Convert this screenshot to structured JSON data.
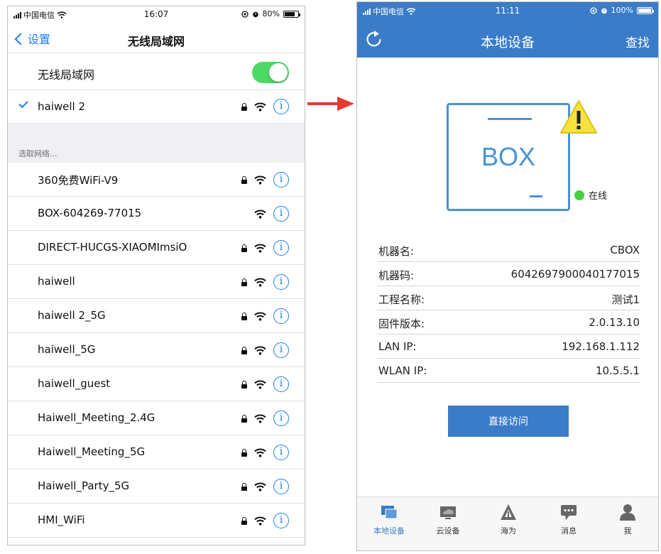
{
  "left_phone": {
    "status": {
      "carrier": "中国电信",
      "time": "16:07",
      "battery": "80%",
      "battery_level": 0.8
    },
    "nav": {
      "back_label": "设置",
      "title": "无线局域网"
    },
    "wlan": {
      "label": "无线局域网",
      "enabled": true
    },
    "connected": {
      "name": "haiwell 2",
      "locked": true
    },
    "section_header": "选取网络...",
    "networks": [
      {
        "name": "360免费WiFi-V9",
        "locked": true
      },
      {
        "name": "BOX-604269-77015",
        "locked": false
      },
      {
        "name": "DIRECT-HUCGS-XIAOMImsiO",
        "locked": true
      },
      {
        "name": "haiwell",
        "locked": true
      },
      {
        "name": "haiwell 2_5G",
        "locked": true
      },
      {
        "name": "haiwell_5G",
        "locked": true
      },
      {
        "name": "haiwell_guest",
        "locked": true
      },
      {
        "name": "Haiwell_Meeting_2.4G",
        "locked": true
      },
      {
        "name": "Haiwell_Meeting_5G",
        "locked": true
      },
      {
        "name": "Haiwell_Party_5G",
        "locked": true
      },
      {
        "name": "HMI_WiFi",
        "locked": true
      }
    ],
    "info_glyph": "i"
  },
  "right_phone": {
    "status": {
      "carrier": "中国电信",
      "time": "11:11",
      "battery": "100%",
      "battery_level": 1.0
    },
    "header": {
      "title": "本地设备",
      "find_label": "查找"
    },
    "device": {
      "box_label": "BOX",
      "status_label": "在线"
    },
    "info": [
      {
        "key": "机器名:",
        "value": "CBOX"
      },
      {
        "key": "机器码:",
        "value": "6042697900040177015"
      },
      {
        "key": "工程名称:",
        "value": "测试1"
      },
      {
        "key": "固件版本:",
        "value": "2.0.13.10"
      },
      {
        "key": "LAN IP:",
        "value": "192.168.1.112"
      },
      {
        "key": "WLAN IP:",
        "value": "10.5.5.1"
      }
    ],
    "access_button": "直接访问",
    "tabs": [
      {
        "label": "本地设备",
        "icon": "local-device-icon",
        "active": true
      },
      {
        "label": "云设备",
        "icon": "cloud-device-icon",
        "active": false
      },
      {
        "label": "海为",
        "icon": "haiwell-logo-icon",
        "active": false
      },
      {
        "label": "消息",
        "icon": "message-icon",
        "active": false
      },
      {
        "label": "我",
        "icon": "user-icon",
        "active": false
      }
    ]
  },
  "colors": {
    "ios_blue": "#1a7ef5",
    "toggle_green": "#4cd964",
    "header_blue": "#3a7cc7",
    "box_blue": "#4a92d6",
    "online_green": "#44d13b",
    "warning_yellow": "#f6e33b",
    "arrow_red": "#e53935"
  }
}
